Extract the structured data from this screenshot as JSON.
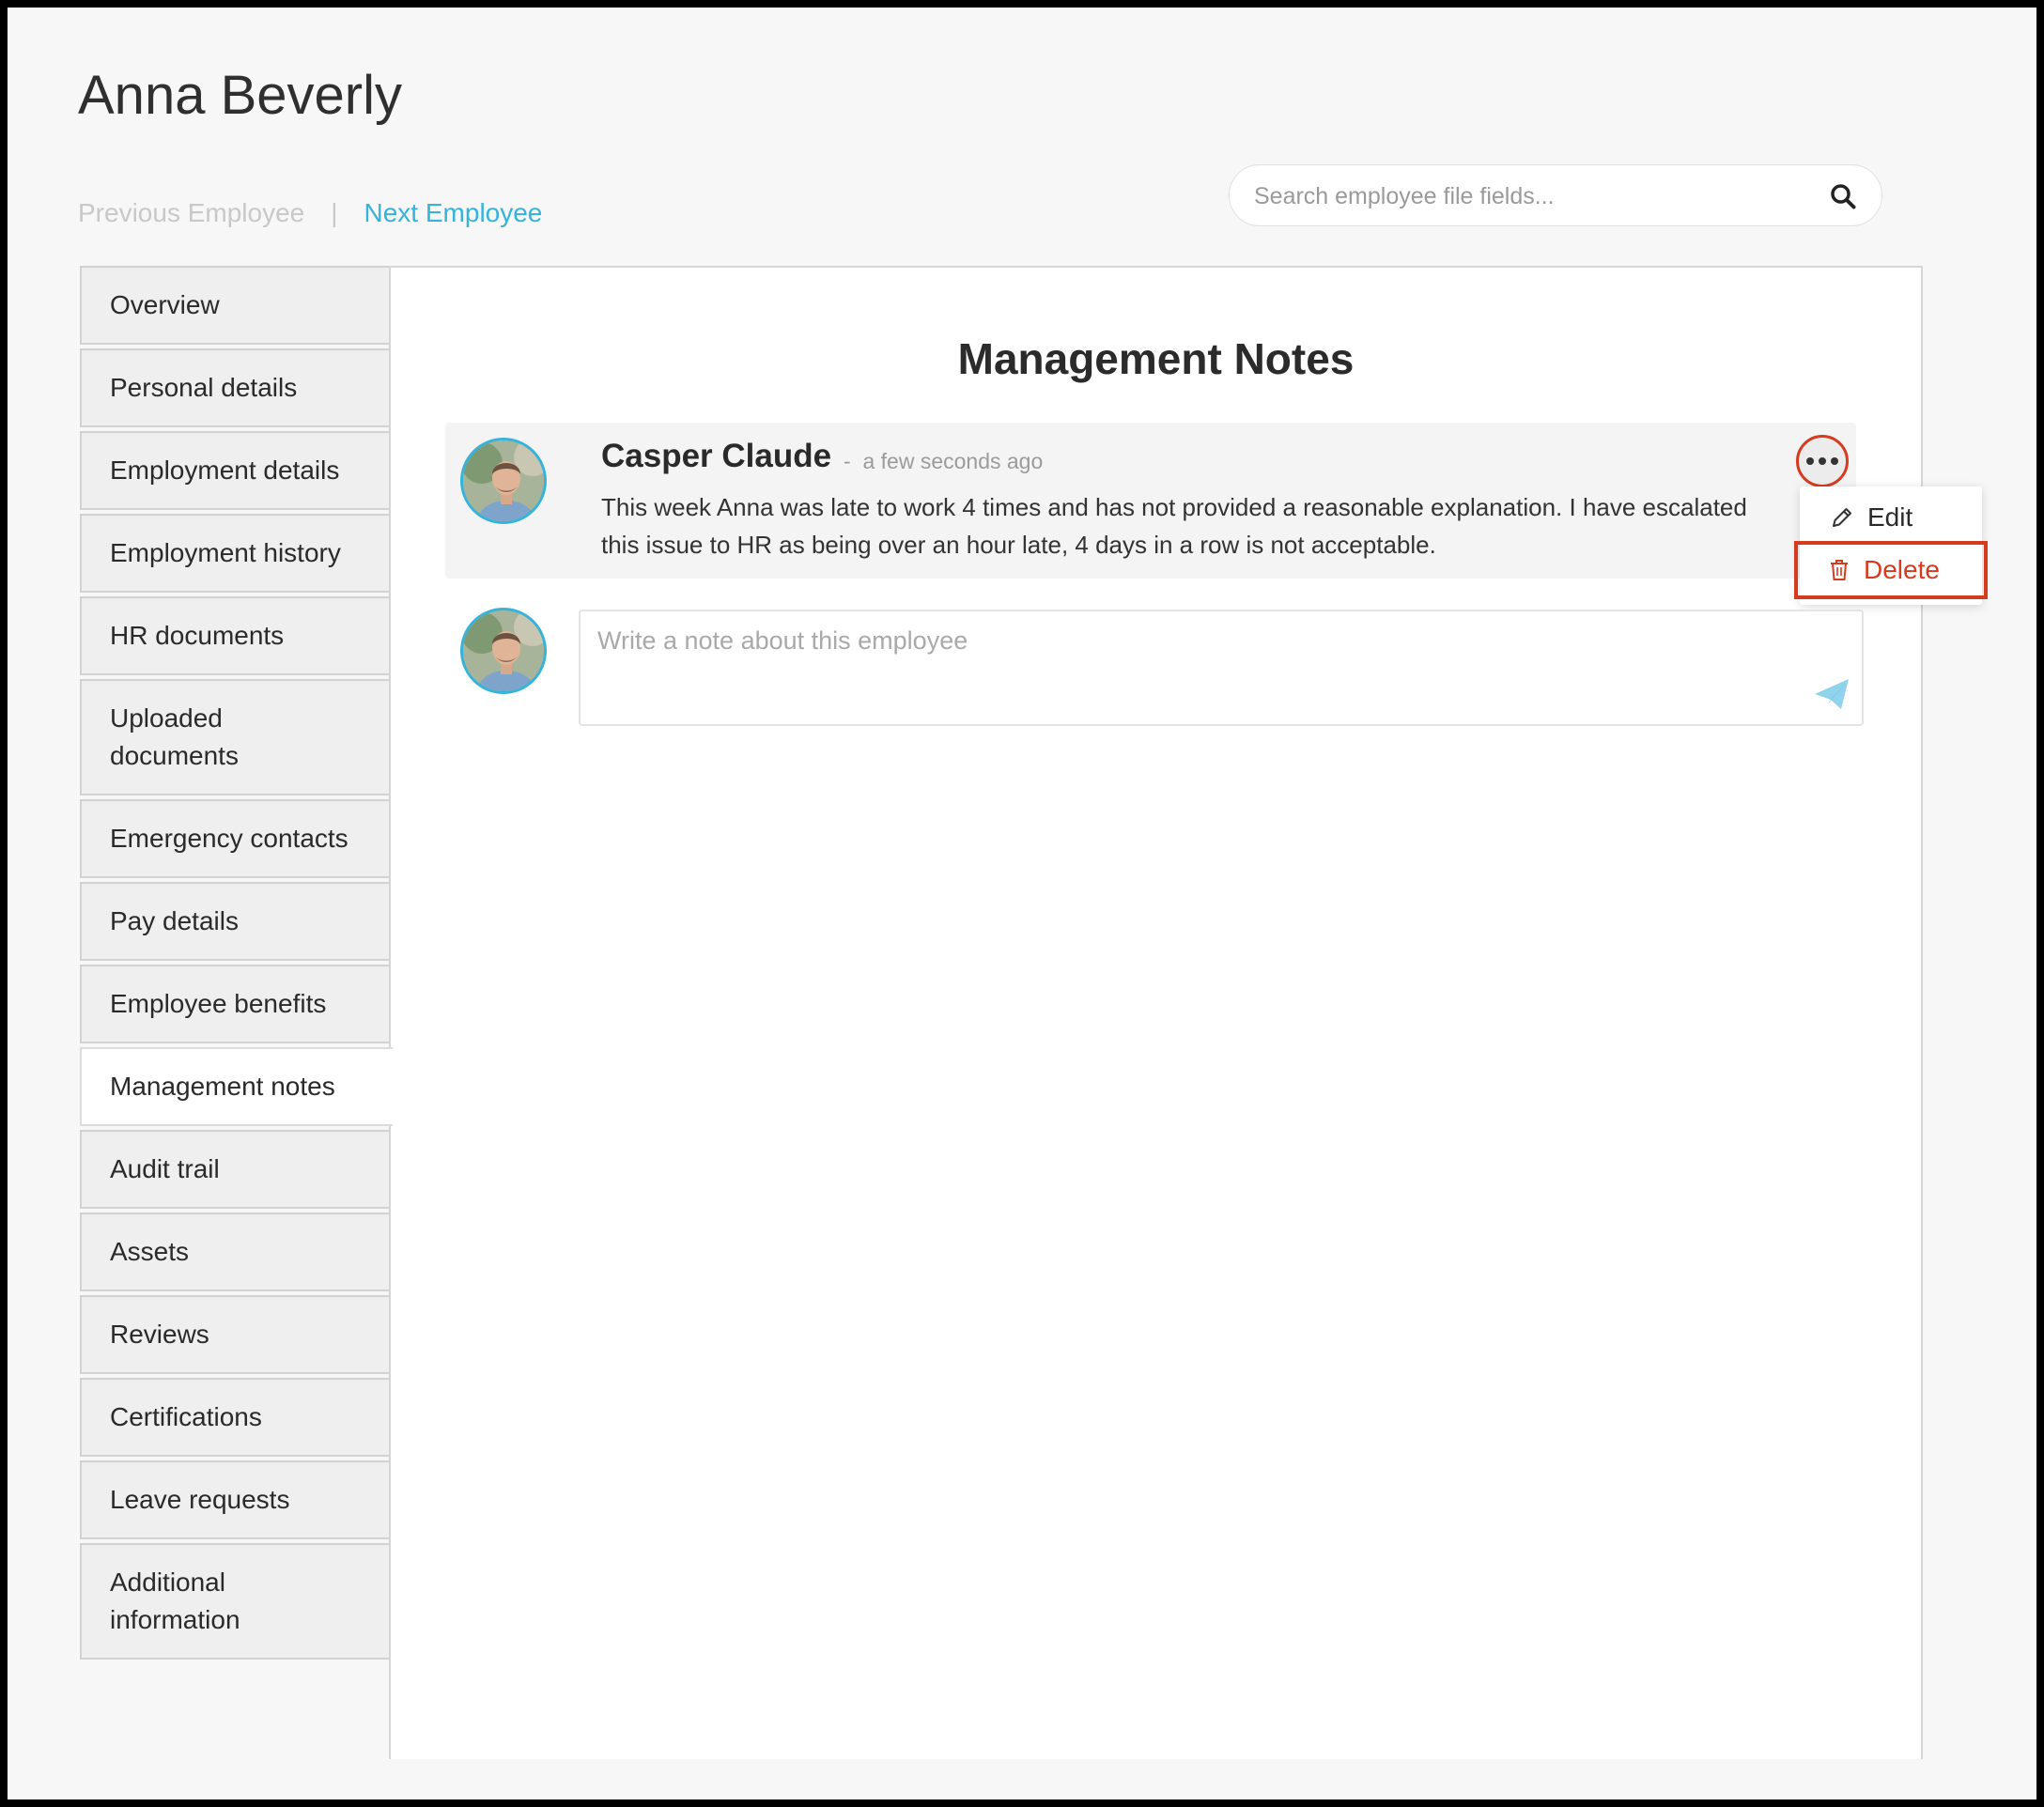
{
  "page": {
    "title": "Anna Beverly"
  },
  "employee_nav": {
    "previous_label": "Previous Employee",
    "separator": "|",
    "next_label": "Next Employee"
  },
  "search": {
    "placeholder": "Search employee file fields...",
    "value": ""
  },
  "sidebar": {
    "items": [
      {
        "label": "Overview",
        "active": false
      },
      {
        "label": "Personal details",
        "active": false
      },
      {
        "label": "Employment details",
        "active": false
      },
      {
        "label": "Employment history",
        "active": false
      },
      {
        "label": "HR documents",
        "active": false
      },
      {
        "label": "Uploaded documents",
        "active": false
      },
      {
        "label": "Emergency contacts",
        "active": false
      },
      {
        "label": "Pay details",
        "active": false
      },
      {
        "label": "Employee benefits",
        "active": false
      },
      {
        "label": "Management notes",
        "active": true
      },
      {
        "label": "Audit trail",
        "active": false
      },
      {
        "label": "Assets",
        "active": false
      },
      {
        "label": "Reviews",
        "active": false
      },
      {
        "label": "Certifications",
        "active": false
      },
      {
        "label": "Leave requests",
        "active": false
      },
      {
        "label": "Additional information",
        "active": false
      }
    ]
  },
  "main": {
    "section_title": "Management Notes",
    "note": {
      "author": "Casper Claude",
      "separator": "-",
      "time": "a few seconds ago",
      "text": "This week Anna was late to work 4 times and has not provided a reasonable explanation. I have escalated this issue to HR as being over an hour late, 4 days in a row is not acceptable."
    },
    "note_menu": {
      "edit_label": "Edit",
      "delete_label": "Delete"
    },
    "compose": {
      "placeholder": "Write a note about this employee",
      "value": ""
    }
  },
  "colors": {
    "accent": "#35b3da",
    "danger": "#d53b1e",
    "background": "#f7f7f7",
    "tab_background": "#efefef"
  },
  "icons": {
    "search": "search-icon",
    "more": "ellipsis-icon",
    "edit": "pencil-icon",
    "delete": "trash-icon",
    "send": "paper-plane-icon",
    "avatar": "user-avatar"
  }
}
